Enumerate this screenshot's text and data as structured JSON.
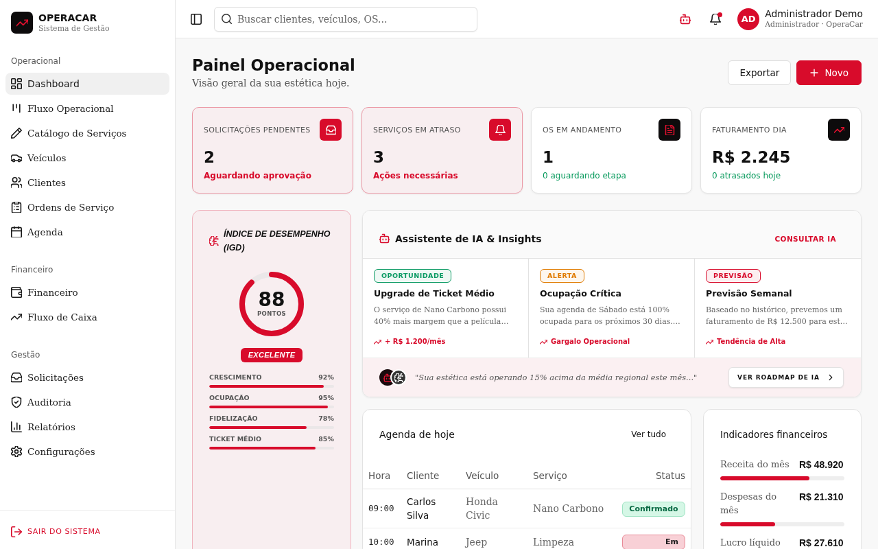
{
  "sidebar": {
    "brand": {
      "name": "OPERACAR",
      "tagline": "Sistema de Gestão"
    },
    "sections": [
      {
        "title": "Operacional",
        "items": [
          {
            "label": "Dashboard",
            "selected": true
          },
          {
            "label": "Fluxo Operacional",
            "selected": false
          },
          {
            "label": "Catálogo de Serviços",
            "selected": false
          },
          {
            "label": "Veículos",
            "selected": false
          },
          {
            "label": "Clientes",
            "selected": false
          },
          {
            "label": "Ordens de Serviço",
            "selected": false
          },
          {
            "label": "Agenda",
            "selected": false
          }
        ]
      },
      {
        "title": "Financeiro",
        "items": [
          {
            "label": "Financeiro",
            "selected": false
          },
          {
            "label": "Fluxo de Caixa",
            "selected": false
          }
        ]
      },
      {
        "title": "Gestão",
        "items": [
          {
            "label": "Solicitações",
            "selected": false
          },
          {
            "label": "Auditoria",
            "selected": false
          },
          {
            "label": "Relatórios",
            "selected": false
          },
          {
            "label": "Configurações",
            "selected": false
          }
        ]
      }
    ],
    "logout": "SAIR DO SISTEMA"
  },
  "header": {
    "search": {
      "placeholder": "Buscar clientes, veículos, OS..."
    },
    "notifications": {
      "unread": true
    },
    "user": {
      "initials": "AD",
      "name": "Administrador Demo",
      "role": "Administrador · OperaCar"
    }
  },
  "page": {
    "title": "Painel Operacional",
    "subtitle": "Visão geral da sua estética hoje.",
    "actions": [
      {
        "label": "Exportar",
        "kind": "secondary"
      },
      {
        "label": "Novo",
        "kind": "primary"
      }
    ]
  },
  "stats": [
    {
      "label": "SOLICITAÇÕES PENDENTES",
      "value": "2",
      "note": "Aguardando aprovação",
      "alert": true
    },
    {
      "label": "SERVIÇOS EM ATRASO",
      "value": "3",
      "note": "Ações necessárias",
      "alert": true
    },
    {
      "label": "OS EM ANDAMENTO",
      "value": "1",
      "note": "0 aguardando etapa",
      "alert": false
    },
    {
      "label": "FATURAMENTO DIA",
      "value": "R$ 2.245",
      "note": "0 atrasados hoje",
      "alert": false
    }
  ],
  "performance": {
    "title": "ÍNDICE DE DESEMPENHO (IGD)",
    "score": "88",
    "unit": "PONTOS",
    "level": 0.88,
    "rating": "EXCELENTE",
    "metrics": [
      {
        "label": "CRESCIMENTO",
        "value": "92%",
        "level": 0.92
      },
      {
        "label": "OCUPAÇÃO",
        "value": "95%",
        "level": 0.95
      },
      {
        "label": "FIDELIZAÇÃO",
        "value": "78%",
        "level": 0.78
      },
      {
        "label": "TICKET MÉDIO",
        "value": "85%",
        "level": 0.85
      }
    ]
  },
  "ai_insights": {
    "title": "Assistente de IA & Insights",
    "action": "CONSULTAR IA",
    "insights": [
      {
        "tag": "OPORTUNIDADE",
        "color": "#0a9a63",
        "title": "Upgrade de Ticket Médio",
        "text": "O serviço de Nano Carbono possui 40% mais margem que a película…",
        "impact": "+ R$ 1.200/mês"
      },
      {
        "tag": "ALERTA",
        "color": "#e07b00",
        "title": "Ocupação Crítica",
        "text": "Sua agenda de Sábado está 100% ocupada para os próximos 30 dias.…",
        "impact": "Gargalo Operacional"
      },
      {
        "tag": "PREVISÃO",
        "color": "#d80b2b",
        "title": "Previsão Semanal",
        "text": "Baseado no histórico, prevemos um faturamento de R$ 12.500 para est…",
        "impact": "Tendência de Alta"
      }
    ],
    "summary": "\"Sua estética está operando 15% acima da média regional este mês...\"",
    "roadmap_button": "VER ROADMAP DE IA"
  },
  "agenda": {
    "title": "Agenda de hoje",
    "action": "Ver tudo",
    "columns": [
      "Hora",
      "Cliente",
      "Veículo",
      "Serviço",
      "Status"
    ],
    "rows": [
      {
        "time": "09:00",
        "client": "Carlos Silva",
        "vehicle": "Honda Civic",
        "service": "Nano Carbono",
        "status": {
          "label": "Confirmado",
          "kind": "confirmed"
        }
      },
      {
        "time": "10:00",
        "client": "Marina",
        "vehicle": "Jeep",
        "service": "Limpeza",
        "status": {
          "label": "Em",
          "kind": "in_progress"
        }
      }
    ]
  },
  "finance": {
    "title": "Indicadores financeiros",
    "items": [
      {
        "label": "Receita do mês",
        "value": "R$ 48.920",
        "level": 0.72
      },
      {
        "label": "Despesas do mês",
        "value": "R$ 21.310",
        "level": 0.44
      },
      {
        "label": "Lucro líquido",
        "value": "R$ 27.610"
      }
    ]
  }
}
